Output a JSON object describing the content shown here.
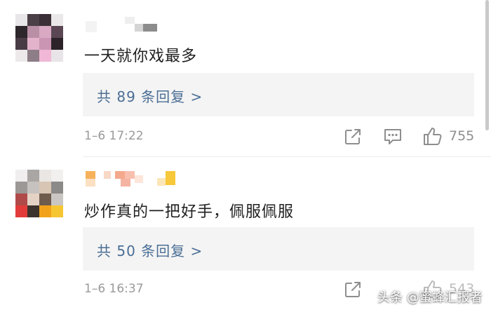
{
  "comments": [
    {
      "text": "一天就你戏最多",
      "reply_label": "共 89 条回复 >",
      "time": "1–6 17:22",
      "likes": "755"
    },
    {
      "text": "炒作真的一把好手，佩服佩服",
      "reply_label": "共 50 条回复 >",
      "time": "1–6 16:37",
      "likes": "543"
    }
  ],
  "icons": [
    "share-icon",
    "comment-icon",
    "thumbs-up-icon"
  ],
  "watermark": "头条 @蜜蜂汇报者"
}
